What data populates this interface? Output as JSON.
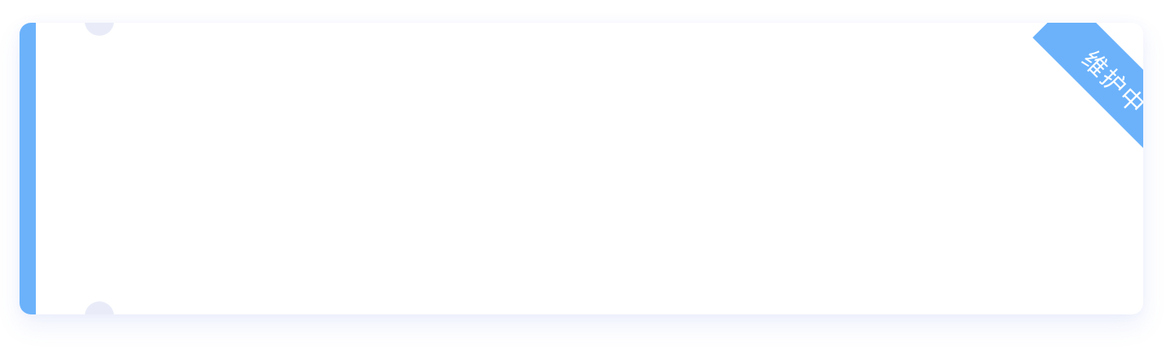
{
  "card": {
    "ribbon_label": "维护中"
  },
  "colors": {
    "accent": "#6bb2fb",
    "notch": "#e9ecf8",
    "card_background": "#ffffff"
  }
}
